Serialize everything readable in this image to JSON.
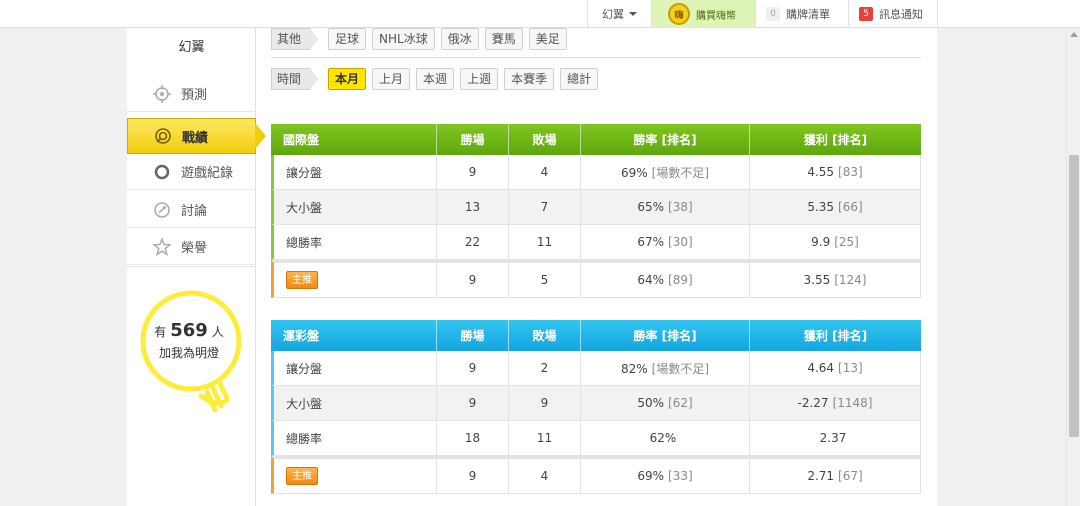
{
  "topbar": {
    "user": "幻翼",
    "buy_label": "購買嗨幣",
    "coin_label": "嗨",
    "cart_count": "0",
    "cart_label": "購牌清單",
    "notice_count": "5",
    "notice_label": "訊息通知"
  },
  "sidebar": {
    "user": "幻翼",
    "items": [
      {
        "label": "預測",
        "icon": "target-icon"
      },
      {
        "label": "戰績",
        "icon": "record-icon"
      },
      {
        "label": "遊戲紀錄",
        "icon": "circle-icon"
      },
      {
        "label": "討論",
        "icon": "discuss-icon"
      },
      {
        "label": "榮譽",
        "icon": "medal-icon"
      }
    ],
    "bulb": {
      "prefix": "有",
      "count": "569",
      "suffix": "人",
      "line2": "加我為明燈"
    }
  },
  "filters": {
    "sport_label": "其他",
    "sports": [
      "足球",
      "NHL冰球",
      "俄冰",
      "賽馬",
      "美足"
    ],
    "time_label": "時間",
    "times": [
      "本月",
      "上月",
      "本週",
      "上週",
      "本賽季",
      "總計"
    ],
    "active_time": "本月"
  },
  "tables": [
    {
      "title": "國際盤",
      "headers": [
        "勝場",
        "敗場",
        "勝率 [排名]",
        "獲利 [排名]"
      ],
      "rows": [
        {
          "name": "讓分盤",
          "win": "9",
          "loss": "4",
          "rate": "69%",
          "rate_rank": "[場數不足]",
          "profit": "4.55",
          "profit_rank": "[83]"
        },
        {
          "name": "大小盤",
          "win": "13",
          "loss": "7",
          "rate": "65%",
          "rate_rank": "[38]",
          "profit": "5.35",
          "profit_rank": "[66]"
        },
        {
          "name": "總勝率",
          "win": "22",
          "loss": "11",
          "rate": "67%",
          "rate_rank": "[30]",
          "profit": "9.9",
          "profit_rank": "[25]"
        }
      ],
      "career": {
        "label": "主推",
        "win": "9",
        "loss": "5",
        "rate": "64%",
        "rate_rank": "[89]",
        "profit": "3.55",
        "profit_rank": "[124]"
      }
    },
    {
      "title": "運彩盤",
      "headers": [
        "勝場",
        "敗場",
        "勝率 [排名]",
        "獲利 [排名]"
      ],
      "rows": [
        {
          "name": "讓分盤",
          "win": "9",
          "loss": "2",
          "rate": "82%",
          "rate_rank": "[場數不足]",
          "profit": "4.64",
          "profit_rank": "[13]"
        },
        {
          "name": "大小盤",
          "win": "9",
          "loss": "9",
          "rate": "50%",
          "rate_rank": "[62]",
          "profit": "-2.27",
          "profit_rank": "[1148]"
        },
        {
          "name": "總勝率",
          "win": "18",
          "loss": "11",
          "rate": "62%",
          "rate_rank": "",
          "profit": "2.37",
          "profit_rank": ""
        }
      ],
      "career": {
        "label": "主推",
        "win": "9",
        "loss": "4",
        "rate": "69%",
        "rate_rank": "[33]",
        "profit": "2.71",
        "profit_rank": "[67]"
      }
    }
  ],
  "colors": {
    "green_header": "#6ab516",
    "blue_header": "#1fb0e6",
    "active_yellow": "#ffe600",
    "notice_red": "#e8403a"
  }
}
